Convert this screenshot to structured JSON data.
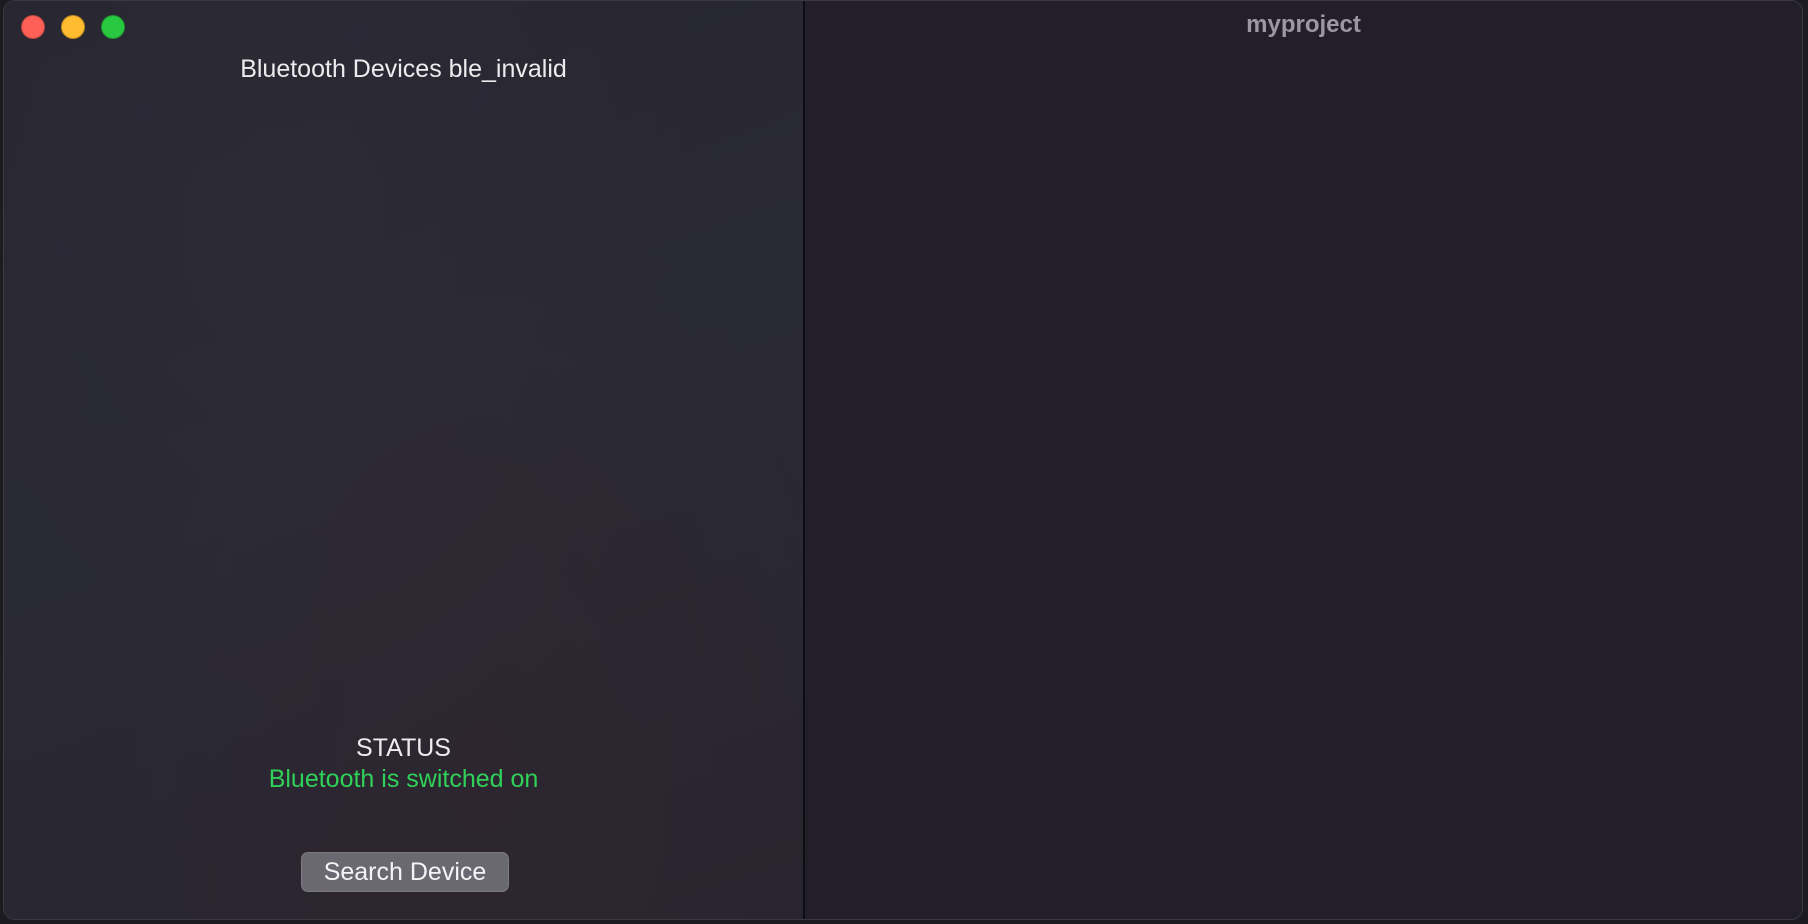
{
  "window": {
    "title": "myproject"
  },
  "sidebar": {
    "heading": "Bluetooth Devices ble_invalid",
    "status_label": "STATUS",
    "status_value": "Bluetooth is switched on",
    "search_button_label": "Search Device"
  },
  "colors": {
    "status_ok": "#30d158",
    "close": "#fe5f57",
    "minimize": "#febc2e",
    "maximize": "#28c840"
  }
}
